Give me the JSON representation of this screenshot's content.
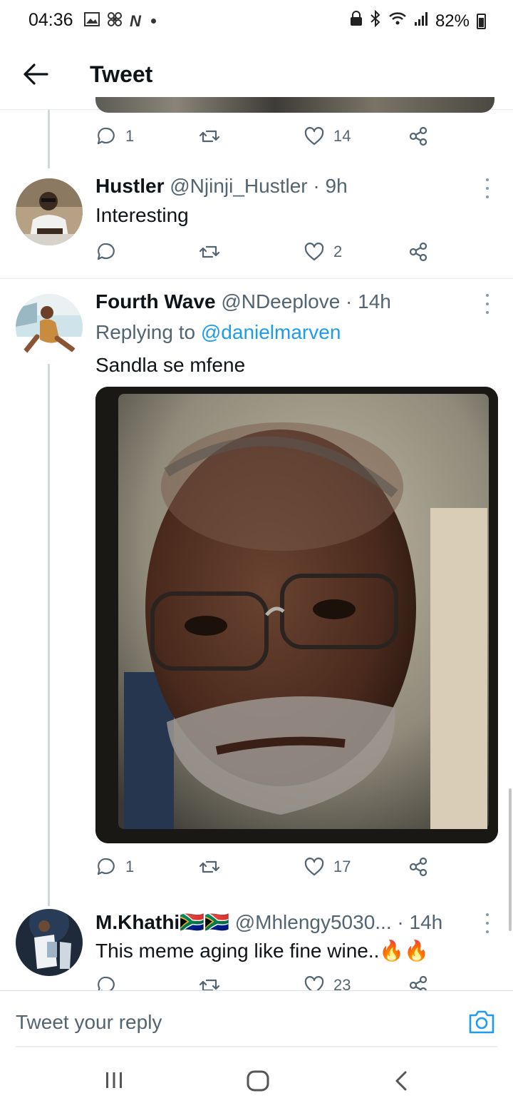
{
  "status_bar": {
    "time": "04:36",
    "battery": "82%"
  },
  "header": {
    "title": "Tweet"
  },
  "top_tweet_actions": {
    "replies": "1",
    "likes": "14"
  },
  "tweets": [
    {
      "name": "Hustler",
      "handle": "@Njinji_Hustler",
      "time": "· 9h",
      "text": "Interesting",
      "replies": "",
      "likes": "2"
    },
    {
      "name": "Fourth Wave",
      "handle": "@NDeeplove",
      "time": "· 14h",
      "replying_prefix": "Replying to",
      "replying_to": "@danielmarven",
      "text": "Sandla se mfene",
      "replies": "1",
      "likes": "17"
    },
    {
      "name": "M.Khathi🇿🇦🇿🇦",
      "handle": "@Mhlengy5030...",
      "time": "· 14h",
      "text": "This meme aging like fine wine..🔥🔥",
      "likes": "23"
    }
  ],
  "reply_bar": {
    "placeholder": "Tweet your reply"
  },
  "colors": {
    "accent": "#1d9bf0",
    "muted": "#536471",
    "divider": "#e6ecf0"
  },
  "icons": [
    "back-arrow-icon",
    "reply-icon",
    "retweet-icon",
    "like-icon",
    "share-icon",
    "more-icon",
    "camera-icon"
  ]
}
